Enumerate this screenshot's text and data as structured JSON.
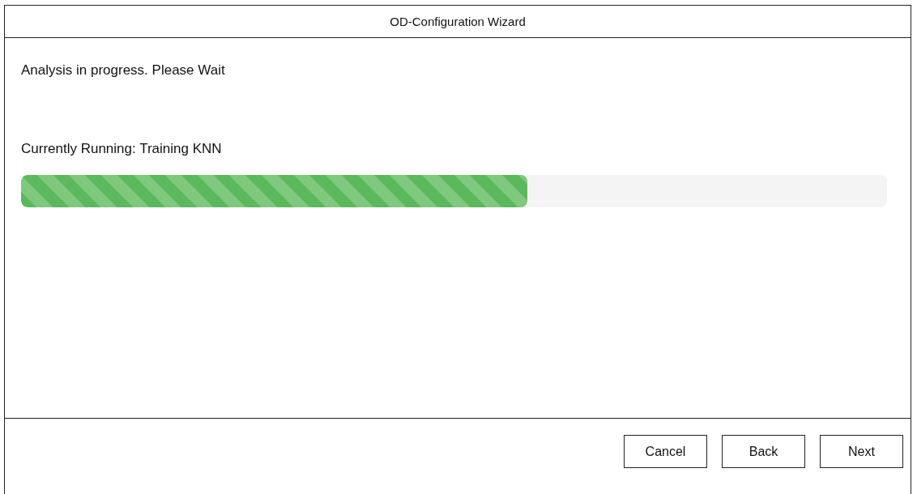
{
  "window": {
    "title": "OD-Configuration Wizard"
  },
  "message": "Analysis in progress. Please Wait",
  "status": "Currently Running: Training KNN",
  "progress": {
    "level": 0.585
  },
  "buttons": [
    {
      "label": "Cancel"
    },
    {
      "label": "Back"
    },
    {
      "label": "Next"
    }
  ]
}
